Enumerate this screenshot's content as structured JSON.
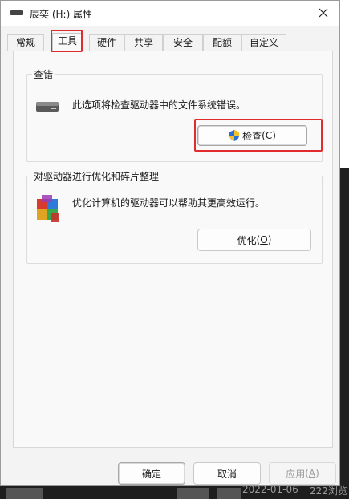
{
  "window": {
    "title": "辰奕 (H:) 属性"
  },
  "tabs": [
    {
      "label": "常规"
    },
    {
      "label": "工具",
      "active": true
    },
    {
      "label": "硬件"
    },
    {
      "label": "共享"
    },
    {
      "label": "安全"
    },
    {
      "label": "配额"
    },
    {
      "label": "自定义"
    }
  ],
  "error_checking": {
    "title": "查错",
    "description": "此选项将检查驱动器中的文件系统错误。",
    "button_label": "检查",
    "button_hotkey": "C",
    "icon": "drive-icon"
  },
  "optimize": {
    "title": "对驱动器进行优化和碎片整理",
    "description": "优化计算机的驱动器可以帮助其更高效运行。",
    "button_label": "优化",
    "button_hotkey": "O",
    "icon": "defrag-icon"
  },
  "footer": {
    "ok_label": "确定",
    "cancel_label": "取消",
    "apply_label": "应用",
    "apply_hotkey": "A"
  },
  "background": {
    "date_text": "2022-01-06",
    "user_text": "222浏览"
  },
  "colors": {
    "highlight": "#e22b2b",
    "shield_blue": "#2a6fd6",
    "shield_yellow": "#f2c12e"
  }
}
